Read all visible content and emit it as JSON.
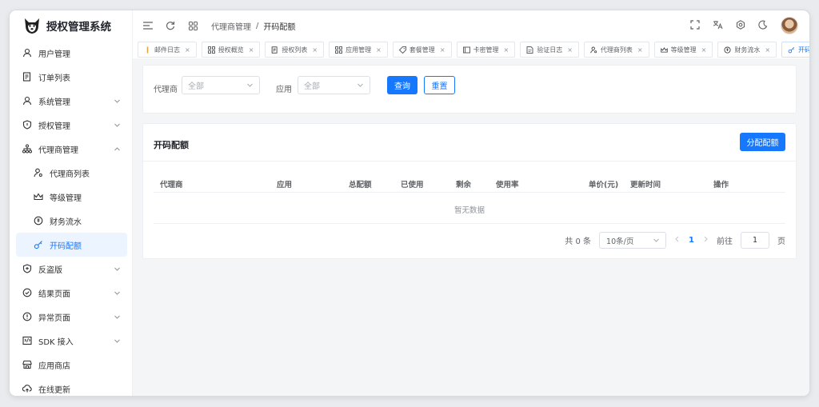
{
  "app": {
    "title": "授权管理系统"
  },
  "sidebar": {
    "items": [
      {
        "label": "用户管理",
        "icon": "user-icon"
      },
      {
        "label": "订单列表",
        "icon": "document-list-icon"
      },
      {
        "label": "系统管理",
        "icon": "user-icon",
        "expandable": true
      },
      {
        "label": "授权管理",
        "icon": "shield-icon",
        "expandable": true
      },
      {
        "label": "代理商管理",
        "icon": "org-chart-icon",
        "expandable": true,
        "expanded": true
      },
      {
        "label": "代理商列表",
        "icon": "user-search-icon",
        "sub": true
      },
      {
        "label": "等级管理",
        "icon": "crown-icon",
        "sub": true
      },
      {
        "label": "财务流水",
        "icon": "money-icon",
        "sub": true
      },
      {
        "label": "开码配额",
        "icon": "key-icon",
        "sub": true,
        "active": true
      },
      {
        "label": "反盗版",
        "icon": "shield-plus-icon",
        "expandable": true
      },
      {
        "label": "结果页面",
        "icon": "check-circle-icon",
        "expandable": true
      },
      {
        "label": "异常页面",
        "icon": "warning-circle-icon",
        "expandable": true
      },
      {
        "label": "SDK 接入",
        "icon": "code-icon",
        "expandable": true
      },
      {
        "label": "应用商店",
        "icon": "store-icon"
      },
      {
        "label": "在线更新",
        "icon": "cloud-upload-icon"
      }
    ]
  },
  "header": {
    "breadcrumb": [
      "代理商管理",
      "开码配额"
    ],
    "separator": "/"
  },
  "tabs": [
    {
      "label": "邮件日志",
      "icon": "mail-icon"
    },
    {
      "label": "授权概览",
      "icon": "grid-icon"
    },
    {
      "label": "授权列表",
      "icon": "document-list-icon"
    },
    {
      "label": "应用管理",
      "icon": "grid-icon"
    },
    {
      "label": "套餐管理",
      "icon": "tag-icon"
    },
    {
      "label": "卡密管理",
      "icon": "card-icon"
    },
    {
      "label": "验证日志",
      "icon": "document-icon"
    },
    {
      "label": "代理商列表",
      "icon": "user-search-icon"
    },
    {
      "label": "等级管理",
      "icon": "crown-icon"
    },
    {
      "label": "财务流水",
      "icon": "money-icon"
    },
    {
      "label": "开码配额",
      "icon": "key-icon",
      "active": true
    }
  ],
  "filter": {
    "agent_label": "代理商",
    "agent_placeholder": "全部",
    "app_label": "应用",
    "app_placeholder": "全部",
    "query_button": "查询",
    "reset_button": "重置"
  },
  "table": {
    "title": "开码配额",
    "assign_button": "分配配额",
    "columns": [
      "代理商",
      "应用",
      "总配额",
      "已使用",
      "剩余",
      "使用率",
      "单价(元)",
      "更新时间",
      "操作"
    ],
    "empty_text": "暂无数据"
  },
  "pagination": {
    "total_text": "共 0 条",
    "page_size": "10条/页",
    "current_page": "1",
    "goto_label": "前往",
    "goto_value": "1",
    "page_suffix": "页"
  },
  "colors": {
    "primary": "#1677ff",
    "active_bg": "#ecf4ff"
  }
}
